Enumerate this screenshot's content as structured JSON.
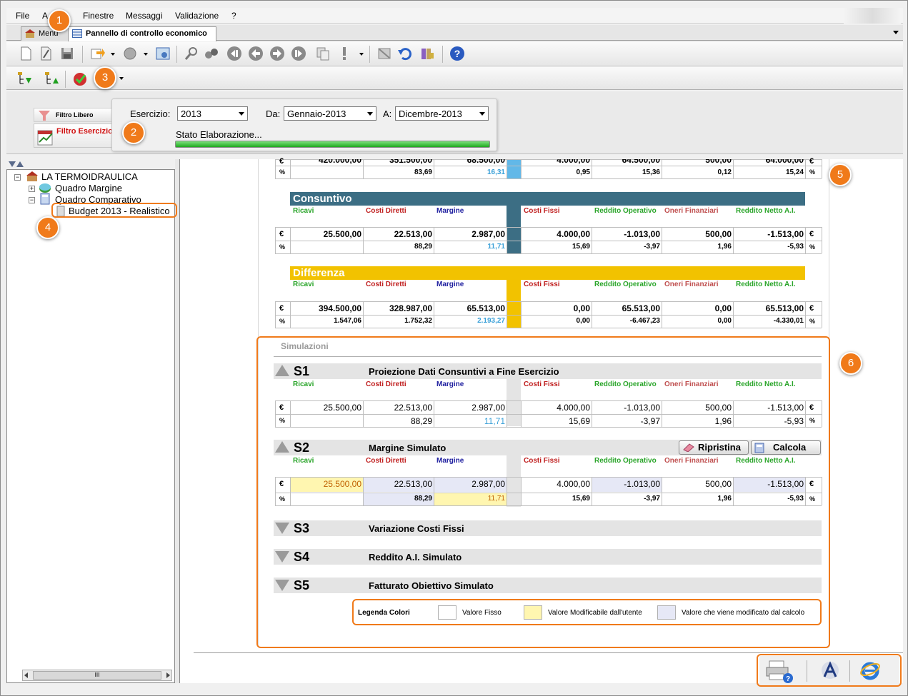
{
  "menu": {
    "file": "File",
    "a": "A",
    "finestre": "Finestre",
    "messaggi": "Messaggi",
    "validazione": "Validazione",
    "help": "?"
  },
  "tabs": {
    "menu": "Menu",
    "active": "Pannello di controllo economico"
  },
  "filters": {
    "filtro_libero": "Filtro Libero",
    "filtro_esercizio": "Filtro Esercizio",
    "esercizio_label": "Esercizio:",
    "esercizio_value": "2013",
    "da_label": "Da:",
    "da_value": "Gennaio-2013",
    "a_label": "A:",
    "a_value": "Dicembre-2013",
    "stato": "Stato Elaborazione..."
  },
  "tree": {
    "root": "LA TERMOIDRAULICA",
    "quadro_margine": "Quadro Margine",
    "quadro_comparativo": "Quadro Comparativo",
    "budget": "Budget 2013 - Realistico"
  },
  "callouts": [
    "1",
    "2",
    "3",
    "4",
    "5",
    "6"
  ],
  "columns": {
    "ricavi": "Ricavi",
    "costi_diretti": "Costi Diretti",
    "margine": "Margine",
    "costi_fissi": "Costi Fissi",
    "reddito_operativo": "Reddito Operativo",
    "oneri_finanziari": "Oneri Finanziari",
    "reddito_netto": "Reddito Netto A.I."
  },
  "units": {
    "euro": "€",
    "pct": "%"
  },
  "top_partial": {
    "euro_row": [
      "420.000,00",
      "351.500,00",
      "68.500,00",
      "4.000,00",
      "64.500,00",
      "500,00",
      "64.000,00"
    ],
    "pct_row": [
      "",
      "83,69",
      "16,31",
      "0,95",
      "15,36",
      "0,12",
      "15,24"
    ]
  },
  "consuntivo": {
    "title": "Consuntivo",
    "euro_row": [
      "25.500,00",
      "22.513,00",
      "2.987,00",
      "4.000,00",
      "-1.013,00",
      "500,00",
      "-1.513,00"
    ],
    "pct_row": [
      "",
      "88,29",
      "11,71",
      "15,69",
      "-3,97",
      "1,96",
      "-5,93"
    ]
  },
  "differenza": {
    "title": "Differenza",
    "euro_row": [
      "394.500,00",
      "328.987,00",
      "65.513,00",
      "0,00",
      "65.513,00",
      "0,00",
      "65.513,00"
    ],
    "pct_row": [
      "1.547,06",
      "1.752,32",
      "2.193,27",
      "0,00",
      "-6.467,23",
      "0,00",
      "-4.330,01"
    ]
  },
  "simulazioni": {
    "title": "Simulazioni",
    "s1": {
      "code": "S1",
      "title": "Proiezione Dati Consuntivi a Fine Esercizio",
      "euro_row": [
        "25.500,00",
        "22.513,00",
        "2.987,00",
        "4.000,00",
        "-1.013,00",
        "500,00",
        "-1.513,00"
      ],
      "pct_row": [
        "",
        "88,29",
        "11,71",
        "15,69",
        "-3,97",
        "1,96",
        "-5,93"
      ]
    },
    "s2": {
      "code": "S2",
      "title": "Margine Simulato",
      "ripristina": "Ripristina",
      "calcola": "Calcola",
      "euro_row": [
        "25.500,00",
        "22.513,00",
        "2.987,00",
        "4.000,00",
        "-1.013,00",
        "500,00",
        "-1.513,00"
      ],
      "pct_row": [
        "",
        "88,29",
        "11,71",
        "15,69",
        "-3,97",
        "1,96",
        "-5,93"
      ]
    },
    "s3": {
      "code": "S3",
      "title": "Variazione Costi Fissi"
    },
    "s4": {
      "code": "S4",
      "title": "Reddito A.I. Simulato"
    },
    "s5": {
      "code": "S5",
      "title": "Fatturato Obiettivo Simulato"
    }
  },
  "legenda": {
    "title": "Legenda Colori",
    "fisso": "Valore Fisso",
    "modificabile": "Valore Modificabile dall'utente",
    "calcolato": "Valore che viene modificato dal calcolo"
  },
  "colors": {
    "consuntivo": "#3c6e84",
    "differenza": "#f2c200",
    "accent": "#f07a1a",
    "editable": "#fff6b0",
    "computed": "#e6e8f6"
  },
  "scroll_label": "III"
}
